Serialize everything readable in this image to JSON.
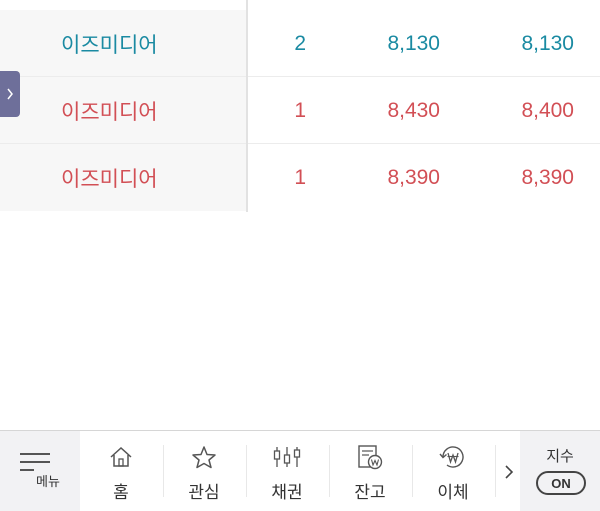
{
  "trades": [
    {
      "name": "이즈미디어",
      "qty": "2",
      "price": "8,130",
      "amount": "8,130",
      "color": "#1a8aa2"
    },
    {
      "name": "이즈미디어",
      "qty": "1",
      "price": "8,430",
      "amount": "8,400",
      "color": "#d24f55"
    },
    {
      "name": "이즈미디어",
      "qty": "1",
      "price": "8,390",
      "amount": "8,390",
      "color": "#d24f55"
    }
  ],
  "side_handle": {
    "icon": "chevron-right-icon"
  },
  "bottom_nav": {
    "menu_label": "메뉴",
    "items": [
      {
        "label": "홈",
        "icon": "home-icon"
      },
      {
        "label": "관심",
        "icon": "star-icon"
      },
      {
        "label": "채권",
        "icon": "candlestick-icon"
      },
      {
        "label": "잔고",
        "icon": "balance-doc-icon"
      },
      {
        "label": "이체",
        "icon": "won-transfer-icon"
      }
    ],
    "more_icon": "chevron-right-icon",
    "index_label": "지수",
    "index_toggle": "ON"
  },
  "colors": {
    "rise": "#d24f55",
    "fall": "#1a8aa2",
    "handle": "#6e6f9a"
  }
}
